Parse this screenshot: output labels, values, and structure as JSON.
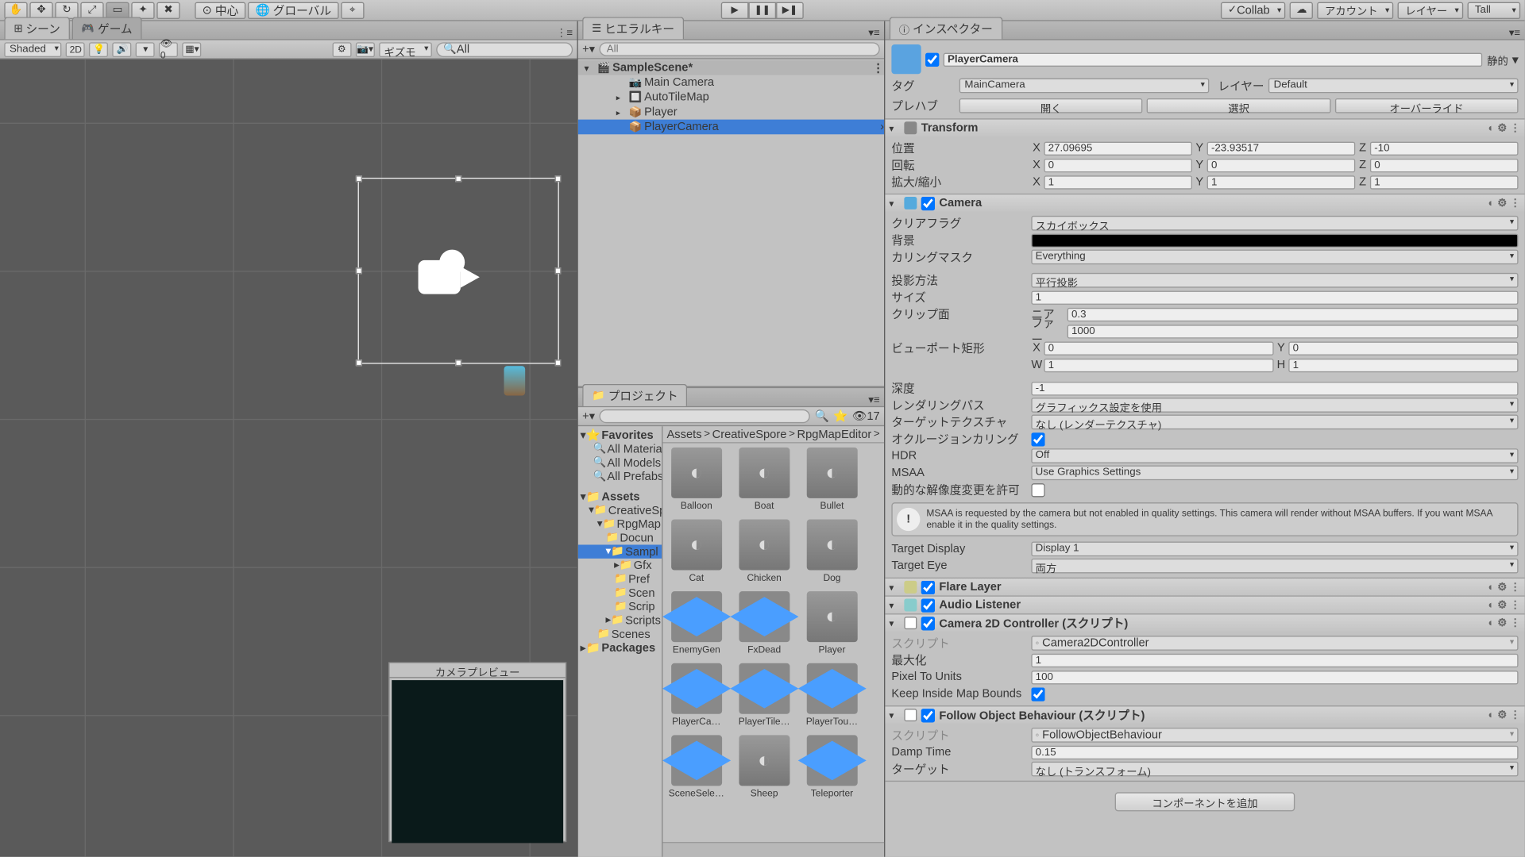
{
  "toolbar": {
    "pivot": "中心",
    "coord": "グローバル",
    "collab": "Collab",
    "account": "アカウント",
    "layers": "レイヤー",
    "layout": "Tall"
  },
  "scene": {
    "tab1": "シーン",
    "tab2": "ゲーム",
    "shading": "Shaded",
    "mode2d": "2D",
    "gizmo": "ギズモ",
    "search": "All",
    "preview": "カメラプレビュー"
  },
  "hierarchy": {
    "title": "ヒエラルキー",
    "search": "All",
    "scene": "SampleScene*",
    "items": [
      "Main Camera",
      "AutoTileMap",
      "Player",
      "PlayerCamera"
    ]
  },
  "project": {
    "title": "プロジェクト",
    "count": "17",
    "fav": "Favorites",
    "fav1": "All Material",
    "fav2": "All Models",
    "fav3": "All Prefabs",
    "assets": "Assets",
    "f1": "CreativeSp",
    "f2": "RpgMap",
    "f3": "Docun",
    "f4": "Sampl",
    "f5": "Gfx",
    "f6": "Pref",
    "f7": "Scen",
    "f8": "Scrip",
    "f9": "Scripts",
    "f10": "Scenes",
    "pkg": "Packages",
    "bc1": "Assets",
    "bc2": "CreativeSpore",
    "bc3": "RpgMapEditor",
    "items": [
      "Balloon",
      "Boat",
      "Bullet",
      "Cat",
      "Chicken",
      "Dog",
      "EnemyGen",
      "FxDead",
      "Player",
      "PlayerCa…",
      "PlayerTile…",
      "PlayerTou…",
      "SceneSele…",
      "Sheep",
      "Teleporter"
    ]
  },
  "inspector": {
    "title": "インスペクター",
    "name": "PlayerCamera",
    "static": "静的",
    "tag": "タグ",
    "tagv": "MainCamera",
    "layer": "レイヤー",
    "layerv": "Default",
    "prefab": "プレハブ",
    "open": "開く",
    "select": "選択",
    "override": "オーバーライド",
    "transform": {
      "t": "Transform",
      "pos": "位置",
      "rot": "回転",
      "scale": "拡大/縮小",
      "px": "27.09695",
      "py": "-23.93517",
      "pz": "-10",
      "rx": "0",
      "ry": "0",
      "rz": "0",
      "sx": "1",
      "sy": "1",
      "sz": "1"
    },
    "camera": {
      "t": "Camera",
      "clear": "クリアフラグ",
      "clearv": "スカイボックス",
      "bg": "背景",
      "cull": "カリングマスク",
      "cullv": "Everything",
      "proj": "投影方法",
      "projv": "平行投影",
      "size": "サイズ",
      "sizev": "1",
      "clip": "クリップ面",
      "near": "ニア",
      "nearv": "0.3",
      "far": "ファー",
      "farv": "1000",
      "vp": "ビューポート矩形",
      "vx": "0",
      "vy": "0",
      "vw": "1",
      "vh": "1",
      "depth": "深度",
      "depthv": "-1",
      "render": "レンダリングパス",
      "renderv": "グラフィックス設定を使用",
      "tex": "ターゲットテクスチャ",
      "texv": "なし (レンダーテクスチャ)",
      "occ": "オクルージョンカリング",
      "hdr": "HDR",
      "hdrv": "Off",
      "msaa": "MSAA",
      "msaav": "Use Graphics Settings",
      "dyn": "動的な解像度変更を許可",
      "msaatxt": "MSAA is requested by the camera but not enabled in quality settings. This camera will render without MSAA buffers. If you want MSAA enable it in the quality settings.",
      "tdisp": "Target Display",
      "tdispv": "Display 1",
      "teye": "Target Eye",
      "teyev": "両方"
    },
    "flare": "Flare Layer",
    "audio": "Audio Listener",
    "cam2d": {
      "t": "Camera 2D Controller (スクリプト)",
      "script": "スクリプト",
      "scriptv": "Camera2DController",
      "max": "最大化",
      "maxv": "1",
      "ptu": "Pixel To Units",
      "ptuv": "100",
      "kimb": "Keep Inside Map Bounds"
    },
    "follow": {
      "t": "Follow Object Behaviour (スクリプト)",
      "script": "スクリプト",
      "scriptv": "FollowObjectBehaviour",
      "damp": "Damp Time",
      "dampv": "0.15",
      "target": "ターゲット",
      "targetv": "なし (トランスフォーム)"
    },
    "addcomp": "コンポーネントを追加"
  }
}
